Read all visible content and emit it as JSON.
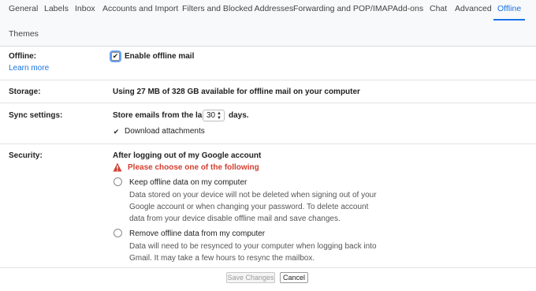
{
  "tabs": [
    {
      "label": "General"
    },
    {
      "label": "Labels"
    },
    {
      "label": "Inbox"
    },
    {
      "label": "Accounts and Import"
    },
    {
      "label": "Filters and Blocked Addresses"
    },
    {
      "label": "Forwarding and POP/IMAP"
    },
    {
      "label": "Add-ons"
    },
    {
      "label": "Chat"
    },
    {
      "label": "Advanced"
    },
    {
      "label": "Offline"
    },
    {
      "label": "Themes"
    }
  ],
  "active_tab": "Offline",
  "offline": {
    "label": "Offline:",
    "learn_more": "Learn more",
    "checkbox_label": "Enable offline mail",
    "enabled": true
  },
  "storage": {
    "label": "Storage:",
    "text": "Using 27 MB of 328 GB available for offline mail on your computer"
  },
  "sync": {
    "label": "Sync settings:",
    "prefix": "Store emails from the last",
    "days_value": "30",
    "suffix": "days.",
    "download_label": "Download attachments",
    "download_checked": true
  },
  "security": {
    "label": "Security:",
    "heading": "After logging out of my Google account",
    "warning": "Please choose one of the following",
    "options": [
      {
        "title": "Keep offline data on my computer",
        "desc": [
          "Data stored on your device will not be deleted when signing out of your",
          "Google account or when changing your password. To delete account",
          "data from your device disable offline mail and save changes."
        ]
      },
      {
        "title": "Remove offline data from my computer",
        "desc": [
          "Data will need to be resynced to your computer when logging back into",
          "Gmail. It may take a few hours to resync the mailbox."
        ]
      }
    ]
  },
  "buttons": {
    "save": "Save Changes",
    "cancel": "Cancel"
  },
  "colors": {
    "accent": "#1a73e8",
    "warning": "#d23f31"
  }
}
